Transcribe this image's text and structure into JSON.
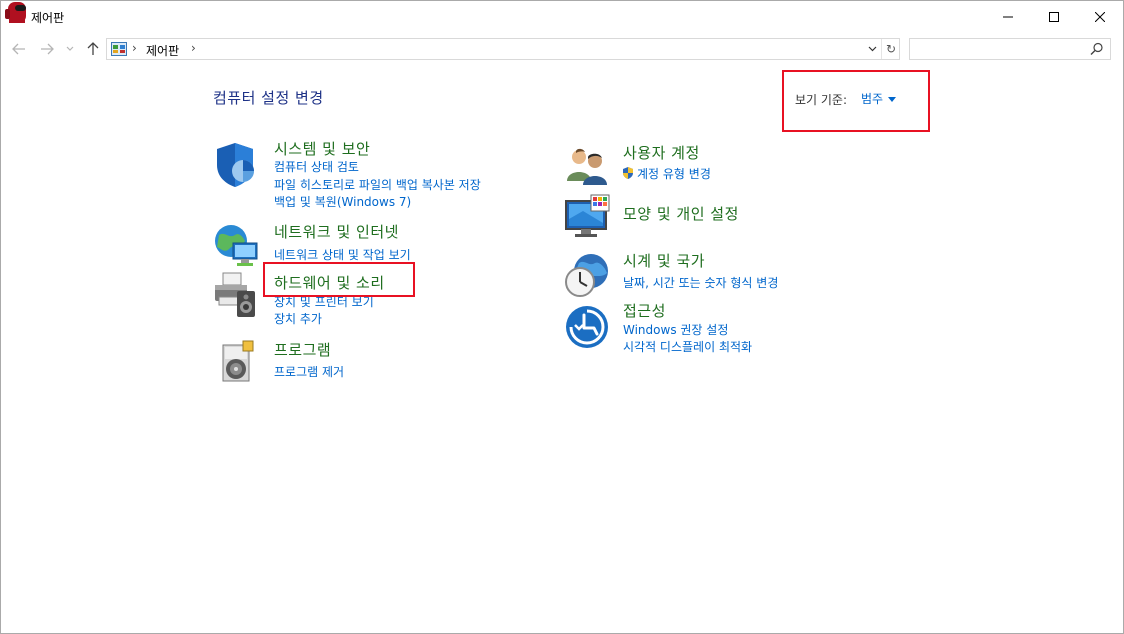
{
  "window": {
    "title": "제어판",
    "colors": {
      "accent_link": "#0066cc",
      "category_title": "#1f6e1f",
      "heading": "#1e3287",
      "highlight_box": "#e81123"
    }
  },
  "nav": {
    "breadcrumb_sep": "›",
    "breadcrumb": "제어판",
    "search_placeholder": "",
    "refresh_glyph": "↻"
  },
  "content": {
    "heading": "컴퓨터 설정 변경",
    "viewby_label": "보기 기준:",
    "viewby_value": "범주",
    "left_categories": [
      {
        "icon": "security-shield-icon",
        "title": "시스템 및 보안",
        "links": [
          "컴퓨터 상태 검토",
          "파일 히스토리로 파일의 백업 복사본 저장",
          "백업 및 복원(Windows 7)"
        ]
      },
      {
        "icon": "network-globe-icon",
        "title": "네트워크 및 인터넷",
        "links": [
          "네트워크 상태 및 작업 보기"
        ]
      },
      {
        "icon": "printer-speaker-icon",
        "title": "하드웨어 및 소리",
        "links": [
          "장치 및 프린터 보기",
          "장치 추가"
        ]
      },
      {
        "icon": "program-disc-icon",
        "title": "프로그램",
        "links": [
          "프로그램 제거"
        ]
      }
    ],
    "right_categories": [
      {
        "icon": "user-accounts-icon",
        "title": "사용자 계정",
        "links": [
          "계정 유형 변경"
        ]
      },
      {
        "icon": "appearance-monitor-icon",
        "title": "모양 및 개인 설정",
        "links": []
      },
      {
        "icon": "clock-globe-icon",
        "title": "시계 및 국가",
        "links": [
          "날짜, 시간 또는 숫자 형식 변경"
        ]
      },
      {
        "icon": "accessibility-icon",
        "title": "접근성",
        "links": [
          "Windows 권장 설정",
          "시각적 디스플레이 최적화"
        ]
      }
    ]
  }
}
